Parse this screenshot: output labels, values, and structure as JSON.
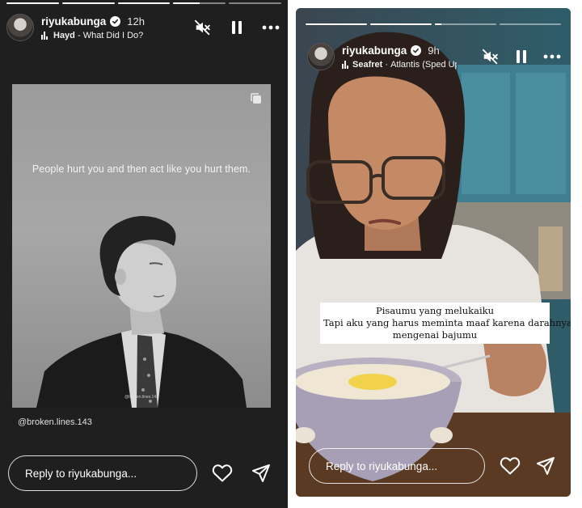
{
  "stories": [
    {
      "username": "riyukabunga",
      "time_ago": "12h",
      "song_artist": "Hayd",
      "song_separator": " - ",
      "song_title": "What Did I Do?",
      "progress": [
        1,
        1,
        1,
        0.5,
        0
      ],
      "quote": "People hurt you and then act like you hurt them.",
      "watermark": "@broken.lines.143",
      "credit": "@broken.lines.143",
      "reply_placeholder": "Reply to riyukabunga..."
    },
    {
      "username": "riyukabunga",
      "time_ago": "9h",
      "song_artist": "Seafret",
      "song_separator": " · ",
      "song_title": "Atlantis (Sped Up",
      "progress": [
        1,
        1,
        0.1,
        0
      ],
      "caption": [
        "Pisaumu yang melukaiku",
        "Tapi aku yang harus meminta maaf karena darahnya",
        "mengenai bajumu"
      ],
      "reply_placeholder": "Reply to riyukabunga..."
    }
  ],
  "icons": {
    "mute": "speaker-muted-icon",
    "pause": "pause-icon",
    "more": "more-options-icon",
    "like": "heart-icon",
    "send": "send-icon",
    "verified": "verified-badge-icon",
    "music": "music-bars-icon",
    "copy": "copy-icon"
  },
  "colors": {
    "background": "#1f1f1f",
    "text": "#ffffff",
    "caption_bg": "#ffffff"
  }
}
